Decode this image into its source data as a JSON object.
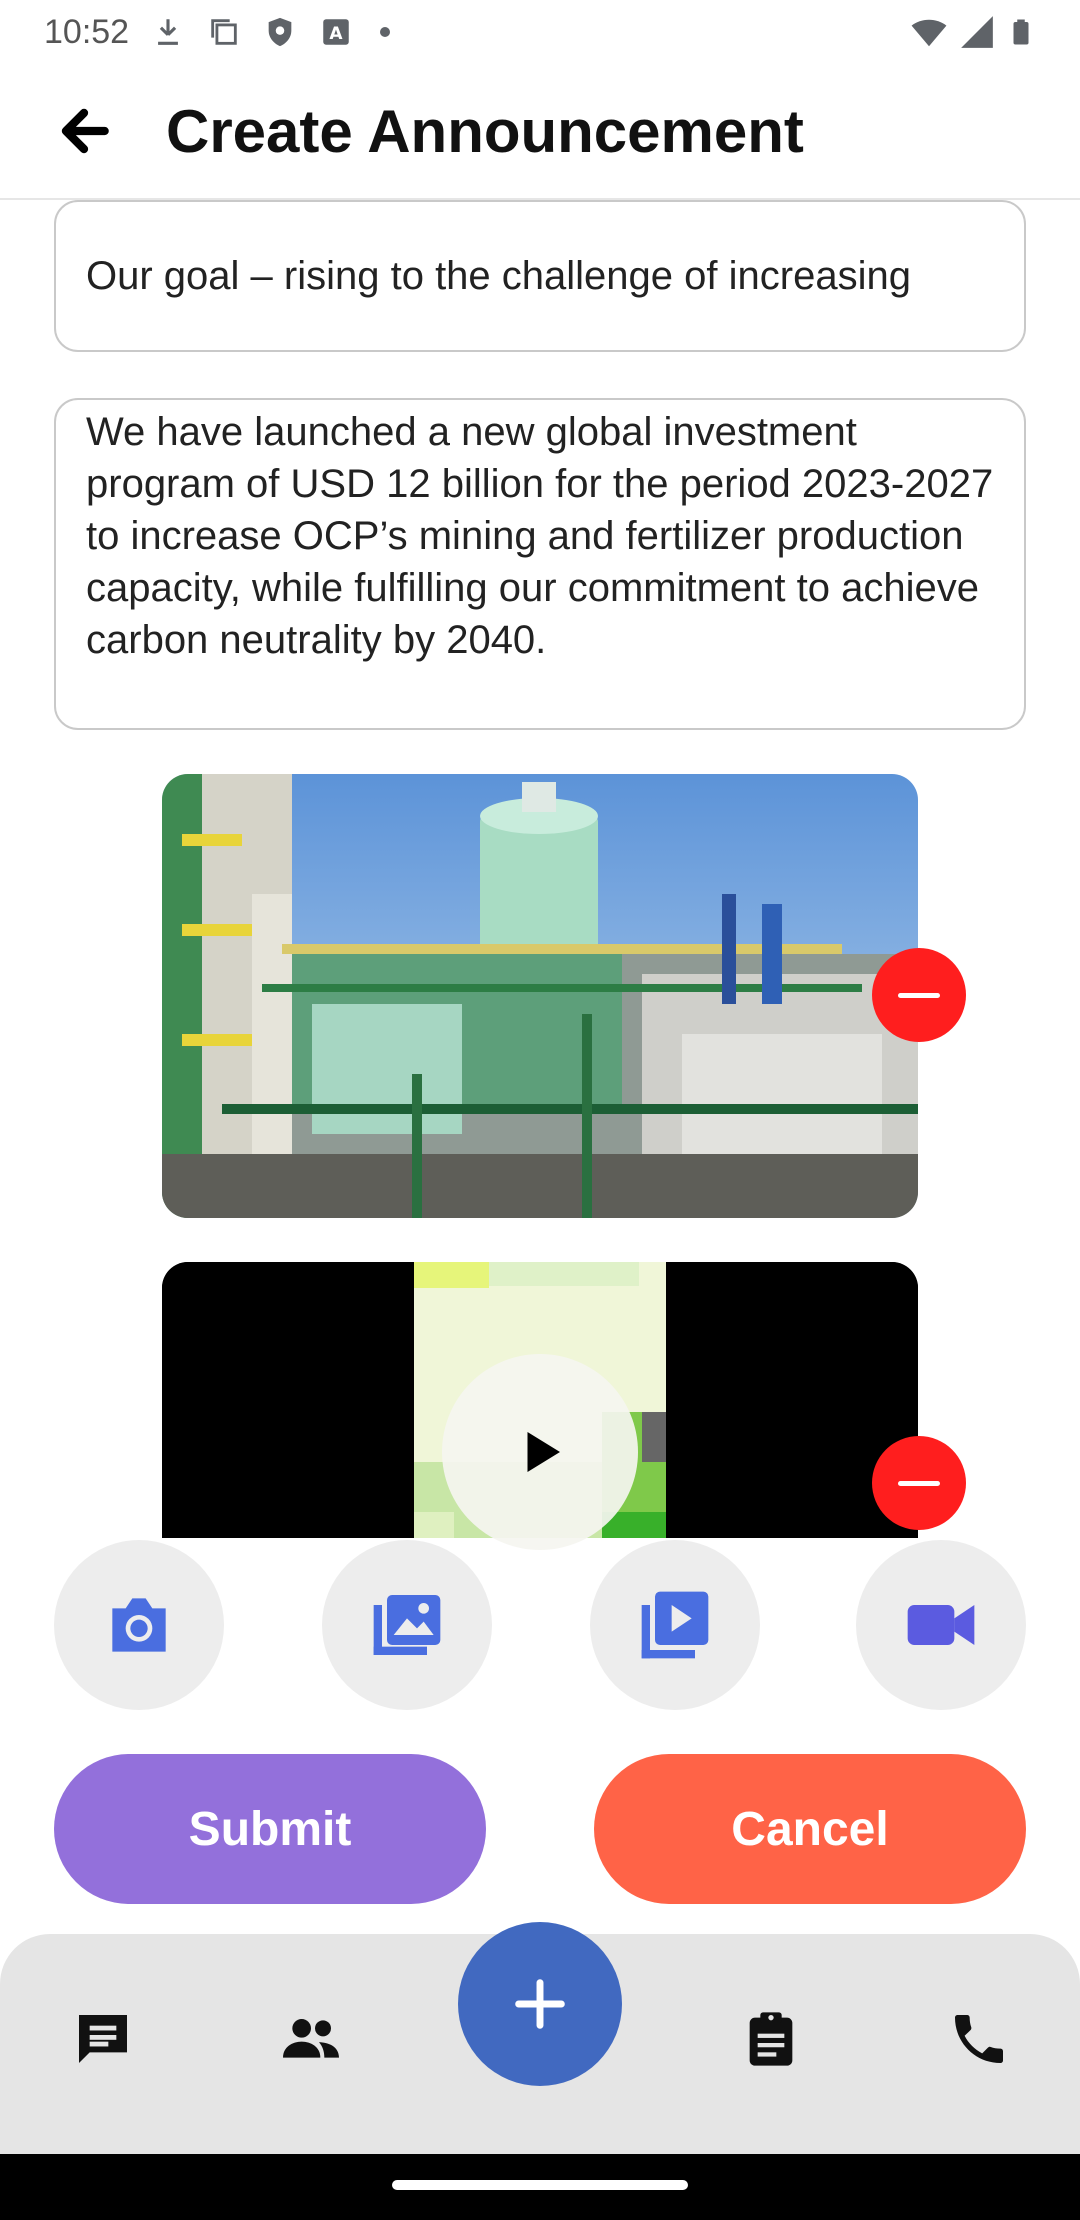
{
  "status_bar": {
    "time": "10:52",
    "left_icons": [
      "download-icon",
      "copy-icon",
      "shield-icon",
      "font-icon",
      "dot-icon"
    ],
    "right_icons": [
      "wifi-icon",
      "signal-icon",
      "battery-icon"
    ]
  },
  "app_bar": {
    "title": "Create Announcement",
    "back_icon": "arrow-back-icon"
  },
  "form": {
    "title_value": "Our goal – rising to the challenge of increasing",
    "body_value": "We have launched a new global investment program of USD 12 billion for the period 2023-2027 to increase OCP’s mining and fertilizer production capacity, while fulfilling our commitment to achieve carbon neutrality by 2040."
  },
  "attachments": [
    {
      "type": "image",
      "remove_icon": "minus-circle-icon"
    },
    {
      "type": "video",
      "play_icon": "play-icon",
      "remove_icon": "minus-circle-icon"
    }
  ],
  "attach_buttons": [
    {
      "icon": "camera-icon"
    },
    {
      "icon": "gallery-icon"
    },
    {
      "icon": "video-library-icon"
    },
    {
      "icon": "videocam-icon"
    }
  ],
  "actions": {
    "submit_label": "Submit",
    "cancel_label": "Cancel"
  },
  "bottom_nav": {
    "items": [
      "chat-icon",
      "people-icon",
      "add-icon",
      "clipboard-icon",
      "phone-icon"
    ]
  },
  "colors": {
    "submit": "#9370db",
    "cancel": "#ff6347",
    "fab": "#4169c0",
    "attach_icon": "#4a6ee0",
    "remove": "#ff1e1e"
  }
}
